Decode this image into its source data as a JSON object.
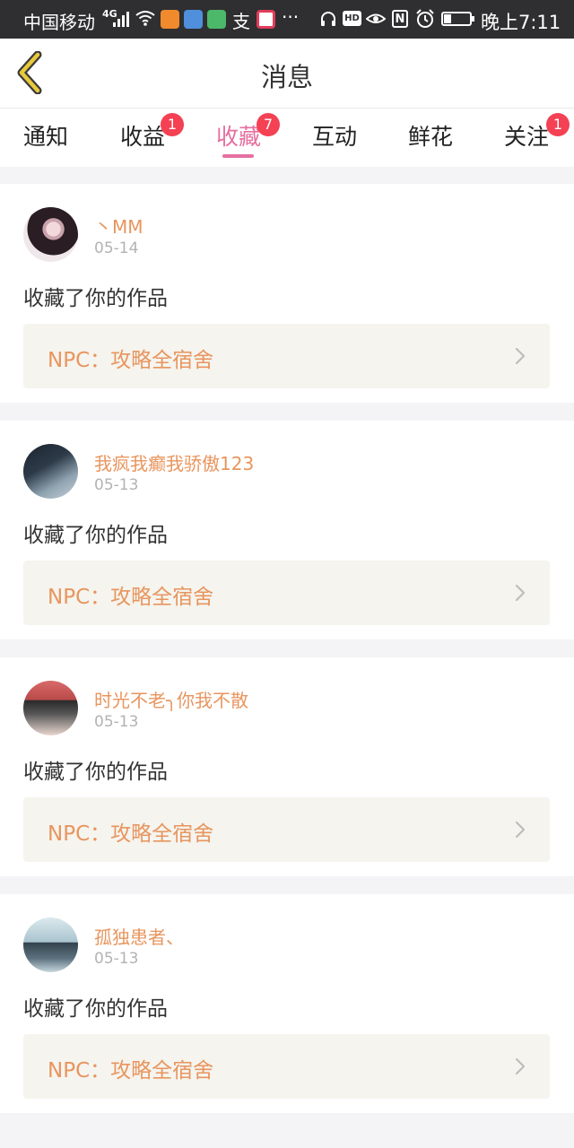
{
  "status_bar": {
    "carrier": "中国移动",
    "network": "4G",
    "battery_level": 0.3,
    "time": "晚上7:11",
    "icons": [
      "signal-icon",
      "wifi-icon",
      "app-icon",
      "app-icon",
      "app-icon",
      "alipay-icon",
      "app-icon",
      "more-icon",
      "headset-icon",
      "hd-icon",
      "eye-icon",
      "nfc-icon",
      "alarm-icon",
      "battery-icon"
    ]
  },
  "header": {
    "title": "消息",
    "back_icon": "chevron-left-icon"
  },
  "tabs": [
    {
      "label": "通知",
      "badge": null,
      "active": false
    },
    {
      "label": "收益",
      "badge": "1",
      "active": false
    },
    {
      "label": "收藏",
      "badge": "7",
      "active": true
    },
    {
      "label": "互动",
      "badge": null,
      "active": false
    },
    {
      "label": "鲜花",
      "badge": null,
      "active": false
    },
    {
      "label": "关注",
      "badge": "1",
      "active": false
    }
  ],
  "notifications": [
    {
      "username": "丶MM",
      "date": "05-14",
      "action": "收藏了你的作品",
      "work_title": "NPC：攻略全宿舍"
    },
    {
      "username": "我疯我癫我骄傲123",
      "date": "05-13",
      "action": "收藏了你的作品",
      "work_title": "NPC：攻略全宿舍"
    },
    {
      "username": "时光不老╮你我不散",
      "date": "05-13",
      "action": "收藏了你的作品",
      "work_title": "NPC：攻略全宿舍"
    },
    {
      "username": "孤独患者、",
      "date": "05-13",
      "action": "收藏了你的作品",
      "work_title": "NPC：攻略全宿舍"
    }
  ],
  "colors": {
    "accent": "#e56fa0",
    "username": "#e8955e",
    "badge": "#f44154",
    "back_icon": "#e8c93a"
  }
}
